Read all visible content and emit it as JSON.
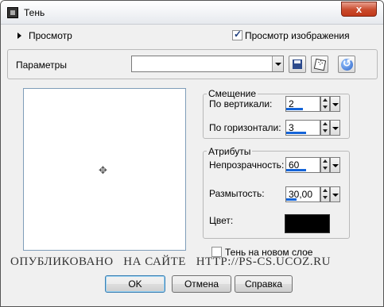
{
  "window": {
    "title": "Тень",
    "close_label": "x"
  },
  "preview_row": {
    "label": "Просмотр",
    "image_preview_checkbox_label": "Просмотр изображения",
    "image_preview_checked": true
  },
  "params": {
    "label": "Параметры",
    "preset_value": ""
  },
  "offset": {
    "title": "Смещение",
    "vertical_label": "По вертикали:",
    "vertical_value": "2",
    "vertical_level": 0.5,
    "horizontal_label": "По горизонтали:",
    "horizontal_value": "3",
    "horizontal_level": 0.6
  },
  "attributes": {
    "title": "Атрибуты",
    "opacity_label": "Непрозрачность:",
    "opacity_value": "60",
    "opacity_level": 0.6,
    "blur_label": "Размытость:",
    "blur_value": "30,00",
    "blur_level": 0.3,
    "color_label": "Цвет:",
    "color_value": "#000000"
  },
  "new_layer": {
    "label": "Тень на новом слое",
    "checked": false
  },
  "watermark": "ОПУБЛИКОВАНО   НА САЙТЕ   HTTP://PS-CS.UCOZ.RU",
  "buttons": {
    "ok": "OK",
    "cancel": "Отмена",
    "help": "Справка"
  },
  "colors": {
    "accent": "#1464d8",
    "close": "#c94a2c"
  }
}
